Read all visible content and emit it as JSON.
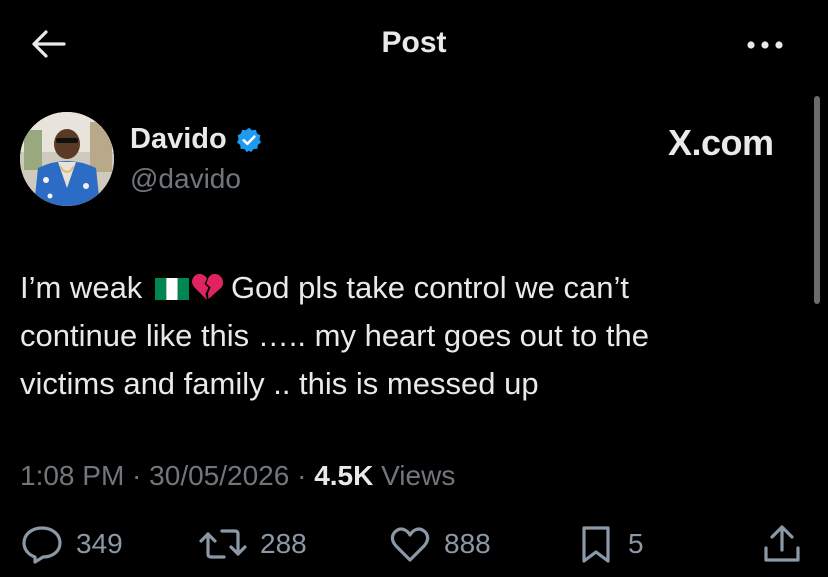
{
  "header": {
    "title": "Post"
  },
  "author": {
    "name": "Davido",
    "handle": "@davido"
  },
  "brand": "X.com",
  "tweet": {
    "line1_pre": "I’m weak",
    "line1_post": "God pls take control we can’t",
    "line2": "continue like this ….. my heart goes out to the",
    "line3": "victims and family .. this is messed up",
    "emojis": [
      "nigeria-flag",
      "broken-heart"
    ]
  },
  "meta": {
    "time": "1:08 PM",
    "separator": " · ",
    "date": "30/05/2026",
    "views_count": "4.5K",
    "views_label": "Views"
  },
  "actions": {
    "replies": "349",
    "reposts": "288",
    "likes": "888",
    "bookmarks": "5"
  },
  "colors": {
    "background": "#000000",
    "text": "#e7e9ea",
    "secondary": "#71767b",
    "verified": "#1d9bf0",
    "flag_green": "#008751",
    "heart_red": "#e0245e"
  }
}
